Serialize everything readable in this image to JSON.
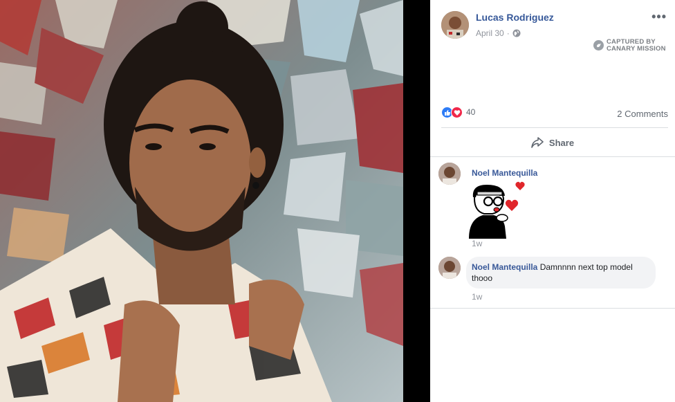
{
  "post": {
    "author": "Lucas Rodriguez",
    "date": "April 30",
    "separator": "·",
    "privacy_icon": "globe-icon",
    "more_label": "•••",
    "captured_line1": "CAPTURED BY",
    "captured_line2": "CANARY MISSION"
  },
  "reactions": {
    "count": "40",
    "types": [
      "like",
      "love"
    ],
    "comments": "2 Comments"
  },
  "actions": {
    "share_label": "Share"
  },
  "comments": [
    {
      "author": "Noel Mantequilla",
      "text": "",
      "sticker": "kiss-hearts-sticker",
      "time": "1w"
    },
    {
      "author": "Noel Mantequilla",
      "text": "Damnnnn next top model thooo",
      "time": "1w"
    }
  ],
  "colors": {
    "link": "#365899",
    "like": "#2e7cf6",
    "love": "#f0284a",
    "heart": "#e0262b"
  }
}
